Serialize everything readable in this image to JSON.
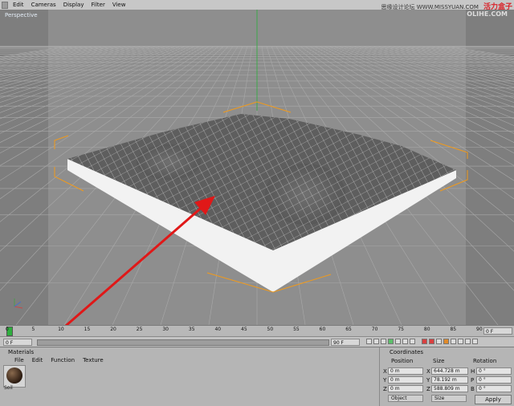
{
  "menubar": {
    "items": [
      "Edit",
      "Cameras",
      "Display",
      "Filter",
      "View"
    ],
    "watermark_cn": "思缘设计论坛 WWW.MISSYUAN.COM",
    "watermark_brand": "活力盒子",
    "watermark_site": "OLIHE.COM"
  },
  "viewport": {
    "label": "Perspective",
    "background_color": "#8e8e8e",
    "grid_color": "#a4a4a4",
    "selection_color": "#f09a1c",
    "arrow_color": "#e01818"
  },
  "timeline": {
    "ticks": [
      "0",
      "5",
      "10",
      "15",
      "20",
      "25",
      "30",
      "35",
      "40",
      "45",
      "50",
      "55",
      "60",
      "65",
      "70",
      "75",
      "80",
      "85",
      "90"
    ],
    "current_frame": "0 F"
  },
  "transport": {
    "start_field": "0 F",
    "end_field": "90 F"
  },
  "materials": {
    "title": "Materials",
    "menu": [
      "File",
      "Edit",
      "Function",
      "Texture"
    ],
    "material_name": "Soil"
  },
  "coordinates": {
    "title": "Coordinates",
    "headers": [
      "Position",
      "Size",
      "Rotation"
    ],
    "rows": [
      {
        "axis": "X",
        "pos": "0 m",
        "size_axis": "X",
        "size": "644.728 m",
        "rot_axis": "H",
        "rot": "0 °"
      },
      {
        "axis": "Y",
        "pos": "0 m",
        "size_axis": "Y",
        "size": "78.192 m",
        "rot_axis": "P",
        "rot": "0 °"
      },
      {
        "axis": "Z",
        "pos": "0 m",
        "size_axis": "Z",
        "size": "588.809 m",
        "rot_axis": "B",
        "rot": "0 °"
      }
    ],
    "mode_select": "Object",
    "size_select": "Size",
    "apply_label": "Apply"
  }
}
